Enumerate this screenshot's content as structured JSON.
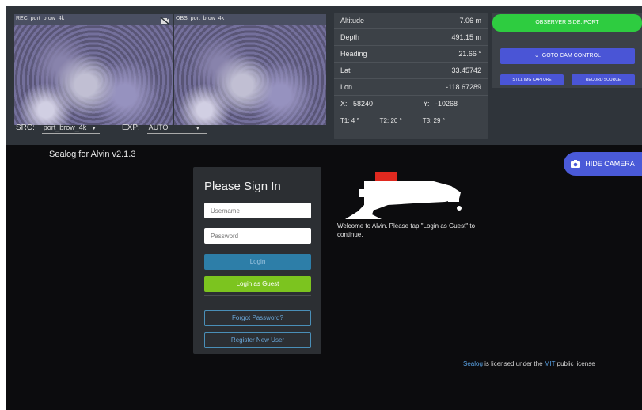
{
  "cameras": {
    "rec_label": "REC: port_brow_4k",
    "obs_label": "OBS: port_brow_4k",
    "src_label": "SRC:",
    "src_value": "port_brow_4k",
    "exp_label": "EXP:",
    "exp_value": "AUTO"
  },
  "telemetry": {
    "rows": [
      {
        "label": "Altitude",
        "value": "7.06 m"
      },
      {
        "label": "Depth",
        "value": "491.15 m"
      },
      {
        "label": "Heading",
        "value": "21.66 °"
      },
      {
        "label": "Lat",
        "value": "33.45742"
      },
      {
        "label": "Lon",
        "value": "-118.67289"
      }
    ],
    "x_label": "X:",
    "x_value": "58240",
    "y_label": "Y:",
    "y_value": "-10268",
    "t1": "T1: 4 °",
    "t2": "T2: 20 °",
    "t3": "T3: 29 °"
  },
  "controls": {
    "observer_side": "OBSERVER SIDE: PORT",
    "goto_cam": "GOTO CAM CONTROL",
    "still_capture": "STILL IMG CAPTURE",
    "record_source": "RECORD SOURCE"
  },
  "app_title": "Sealog for Alvin v2.1.3",
  "hide_camera": "HIDE CAMERA",
  "signin": {
    "title": "Please Sign In",
    "username_placeholder": "Username",
    "password_placeholder": "Password",
    "login": "Login",
    "login_guest": "Login as Guest",
    "forgot": "Forgot Password?",
    "register": "Register New User"
  },
  "welcome": "Welcome to Alvin. Please tap \"Login as Guest\" to continue.",
  "license": {
    "sealog": "Sealog",
    "mid": " is licensed under the ",
    "mit": "MIT",
    "end": " public license"
  },
  "colors": {
    "observer": "#2ecc40",
    "control_buttons": "#4a55d6",
    "login": "#2d7ea8",
    "guest": "#7cc41f",
    "link": "#5aa3e6"
  }
}
